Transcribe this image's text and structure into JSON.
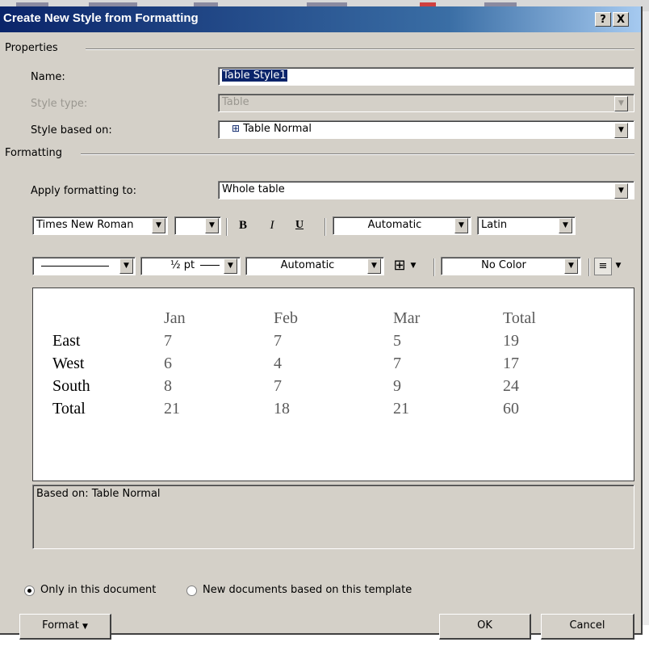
{
  "dialog": {
    "title": "Create New Style from Formatting",
    "help_label": "?",
    "close_label": "X"
  },
  "properties": {
    "group_label": "Properties",
    "name_label": "Name:",
    "name_value": "Table Style1",
    "style_type_label": "Style type:",
    "style_type_value": "Table",
    "based_on_label": "Style based on:",
    "based_on_value": "Table Normal"
  },
  "formatting": {
    "group_label": "Formatting",
    "apply_label": "Apply formatting to:",
    "apply_value": "Whole table",
    "font_name": "Times New Roman",
    "font_size": "",
    "bold_label": "B",
    "italic_label": "I",
    "underline_label": "U",
    "font_color": "Automatic",
    "script": "Latin",
    "line_style": "",
    "line_weight": "½ pt",
    "border_color": "Automatic",
    "shading": "No Color"
  },
  "preview": {
    "headers": [
      "Jan",
      "Feb",
      "Mar",
      "Total"
    ],
    "rows": [
      {
        "label": "East",
        "values": [
          "7",
          "7",
          "5",
          "19"
        ]
      },
      {
        "label": "West",
        "values": [
          "6",
          "4",
          "7",
          "17"
        ]
      },
      {
        "label": "South",
        "values": [
          "8",
          "7",
          "9",
          "24"
        ]
      },
      {
        "label": "Total",
        "values": [
          "21",
          "18",
          "21",
          "60"
        ]
      }
    ]
  },
  "description": "Based on: Table Normal",
  "options": {
    "only_doc_label": "Only in this document",
    "new_docs_label": "New documents based on this template",
    "selected": "only_doc"
  },
  "buttons": {
    "format_label": "Format",
    "ok_label": "OK",
    "cancel_label": "Cancel"
  }
}
